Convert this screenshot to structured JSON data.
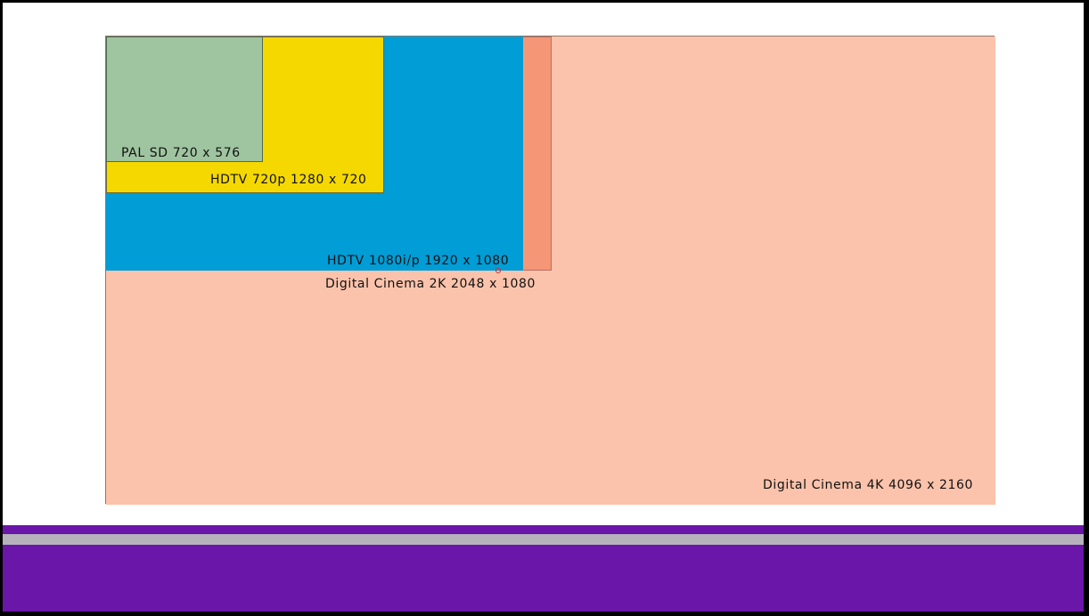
{
  "colors": {
    "background": "#ffffff",
    "pal_sd": "#9fc5a0",
    "hdtv_720p": "#f5d800",
    "hdtv_1080": "#009dd6",
    "cinema_2k": "#f59677",
    "cinema_4k": "#fbc3ab",
    "footer_purple": "#6a16a8",
    "footer_stripe": "#b5b2bb"
  },
  "formats": [
    {
      "name": "PAL SD",
      "width": 720,
      "height": 576,
      "label": "PAL SD 720 x 576"
    },
    {
      "name": "HDTV 720p",
      "width": 1280,
      "height": 720,
      "label": "HDTV 720p 1280 x 720"
    },
    {
      "name": "HDTV 1080i/p",
      "width": 1920,
      "height": 1080,
      "label": "HDTV 1080i/p 1920 x 1080"
    },
    {
      "name": "Digital Cinema 2K",
      "width": 2048,
      "height": 1080,
      "label": "Digital Cinema 2K 2048 x 1080"
    },
    {
      "name": "Digital Cinema 4K",
      "width": 4096,
      "height": 2160,
      "label": "Digital Cinema 4K 4096 x 2160"
    }
  ]
}
